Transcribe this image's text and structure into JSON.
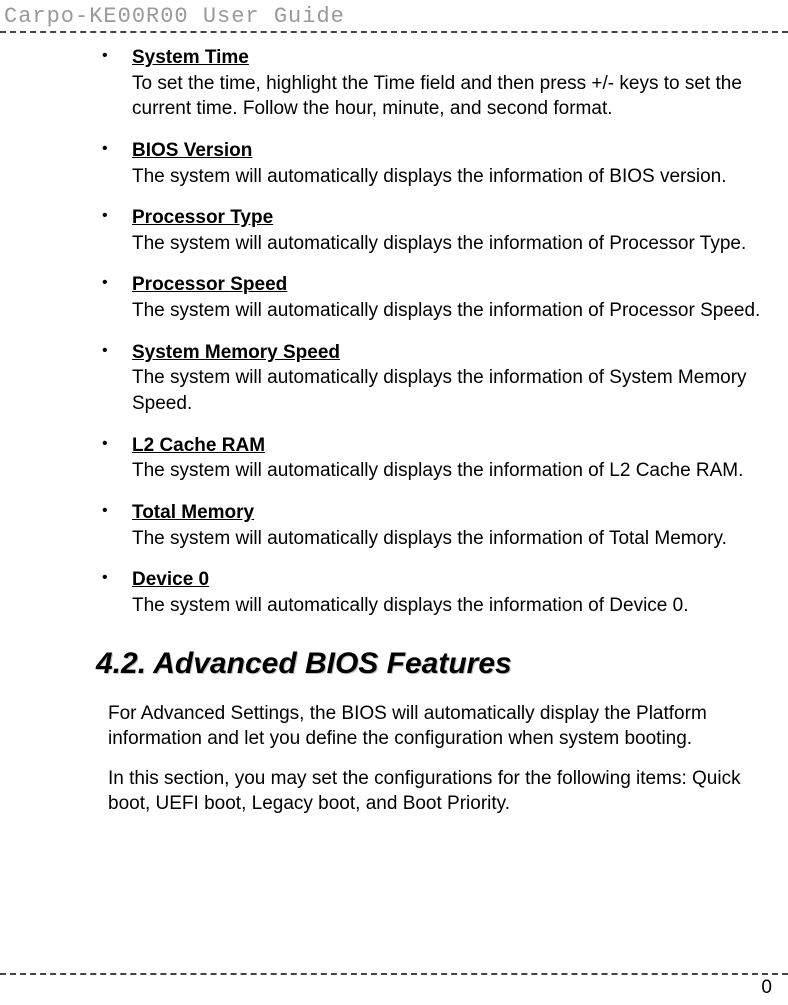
{
  "header": {
    "title": "Carpo-KE00R00 User Guide"
  },
  "items": [
    {
      "title": "System Time",
      "desc": "To set the time, highlight the Time field and then press +/- keys to set the current time. Follow the hour, minute, and second format."
    },
    {
      "title": "BIOS Version",
      "desc": "The system will automatically displays the information of BIOS version."
    },
    {
      "title": "Processor Type",
      "desc": "The system will automatically displays the information of Processor Type."
    },
    {
      "title": "Processor Speed",
      "desc": "The system will automatically displays the information of Processor Speed."
    },
    {
      "title": "System Memory Speed",
      "desc": "The system will automatically displays the information of System Memory Speed."
    },
    {
      "title": "L2 Cache RAM",
      "desc": "The system will automatically displays the information of L2 Cache RAM."
    },
    {
      "title": "Total Memory",
      "desc": "The system will automatically displays the information of Total Memory."
    },
    {
      "title": "Device 0",
      "desc": "The system will automatically displays the information of Device 0."
    }
  ],
  "section": {
    "heading": "4.2. Advanced BIOS Features",
    "para1": "For Advanced Settings, the BIOS will automatically display the Platform information and let you define the configuration when system booting.",
    "para2": "In this section, you may set the configurations for the following items: Quick boot, UEFI boot, Legacy boot, and Boot Priority."
  },
  "footer": {
    "page_number": "0"
  }
}
